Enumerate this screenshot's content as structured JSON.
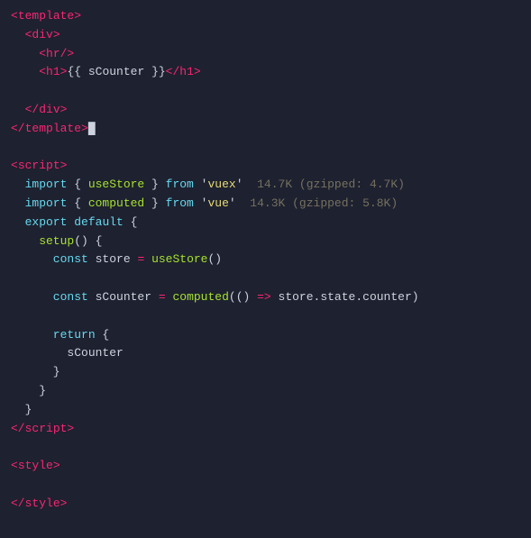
{
  "editor": {
    "background": "#1e2130",
    "lines": [
      {
        "id": "line-1",
        "tokens": [
          {
            "text": "<",
            "color": "pink"
          },
          {
            "text": "template",
            "color": "pink"
          },
          {
            "text": ">",
            "color": "pink"
          }
        ]
      },
      {
        "id": "line-2",
        "tokens": [
          {
            "text": "  <",
            "color": "pink"
          },
          {
            "text": "div",
            "color": "pink"
          },
          {
            "text": ">",
            "color": "pink"
          }
        ]
      },
      {
        "id": "line-3",
        "tokens": [
          {
            "text": "    <",
            "color": "pink"
          },
          {
            "text": "hr",
            "color": "pink"
          },
          {
            "text": "/>",
            "color": "pink"
          }
        ]
      },
      {
        "id": "line-4",
        "tokens": [
          {
            "text": "    <",
            "color": "pink"
          },
          {
            "text": "h1",
            "color": "pink"
          },
          {
            "text": ">",
            "color": "pink"
          },
          {
            "text": "{{ ",
            "color": "white"
          },
          {
            "text": "sCounter",
            "color": "white"
          },
          {
            "text": " }}",
            "color": "white"
          },
          {
            "text": "</",
            "color": "pink"
          },
          {
            "text": "h1",
            "color": "pink"
          },
          {
            "text": ">",
            "color": "pink"
          }
        ]
      },
      {
        "id": "line-5",
        "tokens": []
      },
      {
        "id": "line-6",
        "tokens": [
          {
            "text": "  </",
            "color": "pink"
          },
          {
            "text": "div",
            "color": "pink"
          },
          {
            "text": ">",
            "color": "pink"
          }
        ]
      },
      {
        "id": "line-7",
        "tokens": [
          {
            "text": "</",
            "color": "pink"
          },
          {
            "text": "template",
            "color": "pink"
          },
          {
            "text": ">",
            "color": "pink"
          },
          {
            "text": "█",
            "color": "white"
          }
        ]
      },
      {
        "id": "line-8",
        "tokens": []
      },
      {
        "id": "line-9",
        "tokens": [
          {
            "text": "<",
            "color": "pink"
          },
          {
            "text": "script",
            "color": "pink"
          },
          {
            "text": ">",
            "color": "pink"
          }
        ]
      },
      {
        "id": "line-10",
        "tokens": [
          {
            "text": "  import",
            "color": "teal"
          },
          {
            "text": " { ",
            "color": "white"
          },
          {
            "text": "useStore",
            "color": "green"
          },
          {
            "text": " } ",
            "color": "white"
          },
          {
            "text": "from",
            "color": "teal"
          },
          {
            "text": " '",
            "color": "white"
          },
          {
            "text": "vuex",
            "color": "yellow"
          },
          {
            "text": "'",
            "color": "white"
          },
          {
            "text": "  14.7K (gzipped: 4.7K)",
            "color": "gray"
          }
        ]
      },
      {
        "id": "line-11",
        "tokens": [
          {
            "text": "  import",
            "color": "teal"
          },
          {
            "text": " { ",
            "color": "white"
          },
          {
            "text": "computed",
            "color": "green"
          },
          {
            "text": " } ",
            "color": "white"
          },
          {
            "text": "from",
            "color": "teal"
          },
          {
            "text": " '",
            "color": "white"
          },
          {
            "text": "vue",
            "color": "yellow"
          },
          {
            "text": "'",
            "color": "white"
          },
          {
            "text": "  14.3K (gzipped: 5.8K)",
            "color": "gray"
          }
        ]
      },
      {
        "id": "line-12",
        "tokens": [
          {
            "text": "  export",
            "color": "teal"
          },
          {
            "text": " ",
            "color": "white"
          },
          {
            "text": "default",
            "color": "teal"
          },
          {
            "text": " {",
            "color": "white"
          }
        ]
      },
      {
        "id": "line-13",
        "tokens": [
          {
            "text": "    setup",
            "color": "green"
          },
          {
            "text": "() {",
            "color": "white"
          }
        ]
      },
      {
        "id": "line-14",
        "tokens": [
          {
            "text": "      const",
            "color": "teal"
          },
          {
            "text": " store ",
            "color": "white"
          },
          {
            "text": "=",
            "color": "pink"
          },
          {
            "text": " ",
            "color": "white"
          },
          {
            "text": "useStore",
            "color": "green"
          },
          {
            "text": "()",
            "color": "white"
          }
        ]
      },
      {
        "id": "line-15",
        "tokens": []
      },
      {
        "id": "line-16",
        "tokens": [
          {
            "text": "      const",
            "color": "teal"
          },
          {
            "text": " sCounter ",
            "color": "white"
          },
          {
            "text": "=",
            "color": "pink"
          },
          {
            "text": " ",
            "color": "white"
          },
          {
            "text": "computed",
            "color": "green"
          },
          {
            "text": "(() ",
            "color": "white"
          },
          {
            "text": "=>",
            "color": "pink"
          },
          {
            "text": " store.",
            "color": "white"
          },
          {
            "text": "state",
            "color": "white"
          },
          {
            "text": ".",
            "color": "white"
          },
          {
            "text": "counter",
            "color": "white"
          },
          {
            "text": ")",
            "color": "white"
          }
        ]
      },
      {
        "id": "line-17",
        "tokens": []
      },
      {
        "id": "line-18",
        "tokens": [
          {
            "text": "      return",
            "color": "teal"
          },
          {
            "text": " {",
            "color": "white"
          }
        ]
      },
      {
        "id": "line-19",
        "tokens": [
          {
            "text": "        sCounter",
            "color": "white"
          }
        ]
      },
      {
        "id": "line-20",
        "tokens": [
          {
            "text": "      }",
            "color": "white"
          }
        ]
      },
      {
        "id": "line-21",
        "tokens": [
          {
            "text": "    }",
            "color": "white"
          }
        ]
      },
      {
        "id": "line-22",
        "tokens": [
          {
            "text": "  }",
            "color": "white"
          }
        ]
      },
      {
        "id": "line-23",
        "tokens": [
          {
            "text": "</",
            "color": "pink"
          },
          {
            "text": "script",
            "color": "pink"
          },
          {
            "text": ">",
            "color": "pink"
          }
        ]
      },
      {
        "id": "line-24",
        "tokens": []
      },
      {
        "id": "line-25",
        "tokens": [
          {
            "text": "<",
            "color": "pink"
          },
          {
            "text": "style",
            "color": "pink"
          },
          {
            "text": ">",
            "color": "pink"
          }
        ]
      },
      {
        "id": "line-26",
        "tokens": []
      },
      {
        "id": "line-27",
        "tokens": [
          {
            "text": "</",
            "color": "pink"
          },
          {
            "text": "style",
            "color": "pink"
          },
          {
            "text": ">",
            "color": "pink"
          }
        ]
      }
    ]
  }
}
